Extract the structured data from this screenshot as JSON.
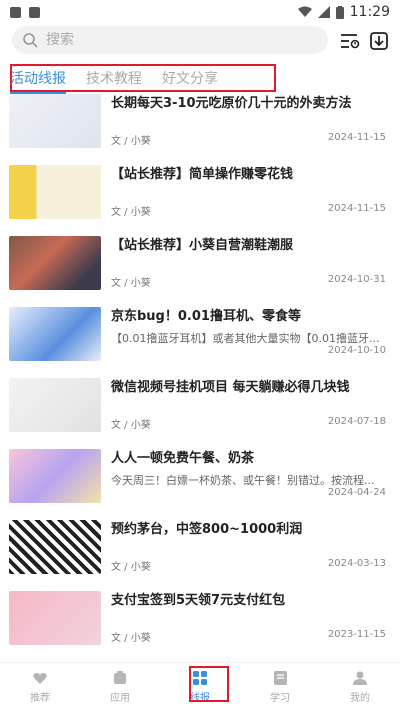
{
  "status_bar": {
    "time": "11:29"
  },
  "search": {
    "placeholder": "搜索"
  },
  "tabs": [
    {
      "label": "活动线报",
      "active": true
    },
    {
      "label": "技术教程",
      "active": false
    },
    {
      "label": "好文分享",
      "active": false
    }
  ],
  "articles": [
    {
      "title": "长期每天3-10元吃原价几十元的外卖方法",
      "desc": "",
      "author": "文 / 小葵",
      "date": "2024-11-15"
    },
    {
      "title": "【站长推荐】简单操作赚零花钱",
      "desc": "",
      "author": "文 / 小葵",
      "date": "2024-11-15"
    },
    {
      "title": "【站长推荐】小葵自营潮鞋潮服",
      "desc": "",
      "author": "文 / 小葵",
      "date": "2024-10-31"
    },
    {
      "title": "京东bug！0.01撸耳机、零食等",
      "desc": "【0.01撸蓝牙耳机】或者其他大量实物【0.01撸蓝牙...",
      "author": "文 / 小葵",
      "date": "2024-10-10"
    },
    {
      "title": "微信视频号挂机项目 每天躺赚必得几块钱",
      "desc": "",
      "author": "文 / 小葵",
      "date": "2024-07-18"
    },
    {
      "title": "人人一顿免费午餐、奶茶",
      "desc": "今天周三！白嫖一杯奶茶、或午餐！别错过。按流程...",
      "author": "文 / 小葵",
      "date": "2024-04-24"
    },
    {
      "title": "预约茅台，中签800~1000利润",
      "desc": "",
      "author": "文 / 小葵",
      "date": "2024-03-13"
    },
    {
      "title": "支付宝签到5天领7元支付红包",
      "desc": "",
      "author": "文 / 小葵",
      "date": "2023-11-15"
    }
  ],
  "bottom_nav": [
    {
      "label": "推荐",
      "icon": "heart-icon",
      "active": false
    },
    {
      "label": "应用",
      "icon": "app-icon",
      "active": false
    },
    {
      "label": "线报",
      "icon": "grid-icon",
      "active": true
    },
    {
      "label": "学习",
      "icon": "book-icon",
      "active": false
    },
    {
      "label": "我的",
      "icon": "user-icon",
      "active": false
    }
  ],
  "colors": {
    "accent": "#3a8fe0",
    "highlight_box": "#e1192e"
  }
}
